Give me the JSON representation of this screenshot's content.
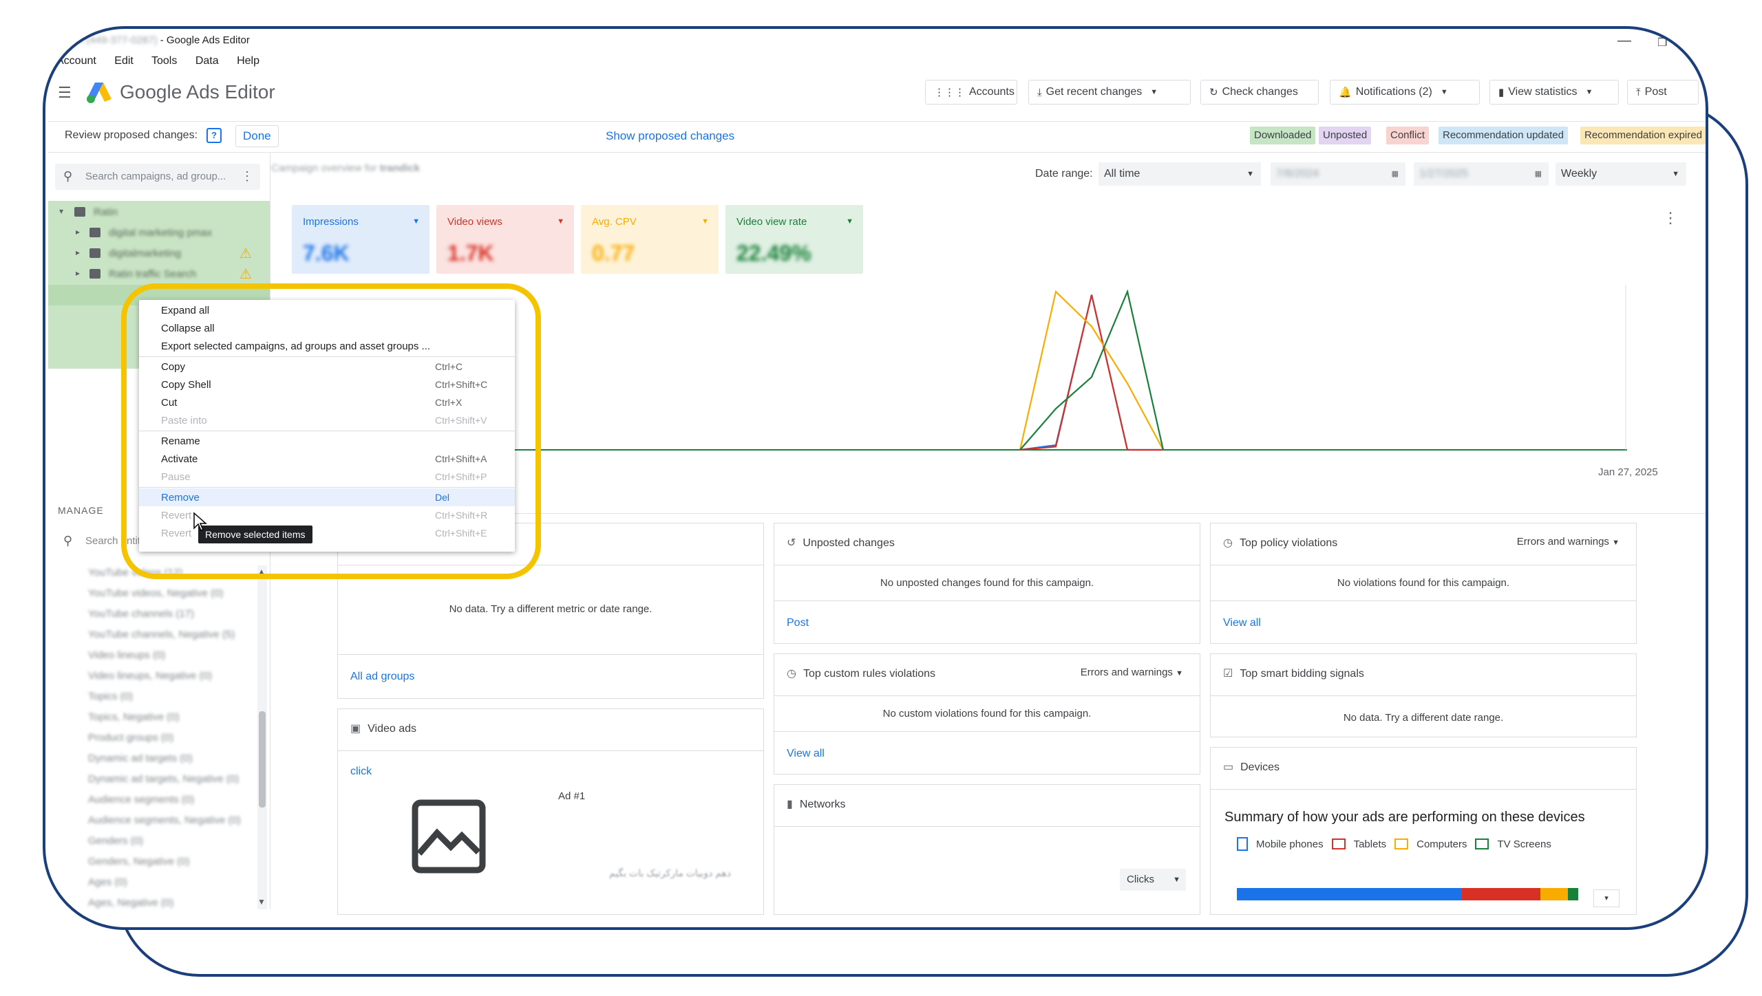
{
  "window": {
    "title_blurred": "Ratin (449-377-0287)",
    "title_suffix": " - Google Ads Editor",
    "minimize": "—",
    "restore": "❐"
  },
  "menu": {
    "account": "Account",
    "edit": "Edit",
    "tools": "Tools",
    "data": "Data",
    "help": "Help"
  },
  "header": {
    "app_title": "Google Ads Editor",
    "accounts": "Accounts",
    "get_recent": "Get recent changes",
    "check_changes": "Check changes",
    "notifications": "Notifications (2)",
    "view_statistics": "View statistics",
    "post": "Post"
  },
  "review": {
    "label": "Review proposed changes:",
    "help": "?",
    "done": "Done",
    "show": "Show proposed changes",
    "badges": {
      "downloaded": "Downloaded",
      "unposted": "Unposted",
      "conflict": "Conflict",
      "rec_updated": "Recommendation updated",
      "rec_expired": "Recommendation expired"
    },
    "colors": {
      "downloaded": "#c6e5c4",
      "unposted": "#e3d4f2",
      "conflict": "#f9d3d0",
      "rec_updated": "#cfe6f7",
      "rec_expired": "#fbe7b5"
    }
  },
  "sidebar": {
    "search_placeholder": "Search campaigns, ad group...",
    "tree": [
      {
        "label": "Ratin"
      },
      {
        "label": "digital marketing pmax"
      },
      {
        "label": "digitalmarketing"
      },
      {
        "label": "Ratin traffic Search"
      }
    ],
    "manage_label": "MANAGE",
    "manage_search_placeholder": "Search entities",
    "manage_items": [
      "YouTube videos (12)",
      "YouTube videos, Negative (0)",
      "YouTube channels (17)",
      "YouTube channels, Negative (5)",
      "Video lineups (0)",
      "Video lineups, Negative (0)",
      "Topics (0)",
      "Topics, Negative (0)",
      "Product groups (0)",
      "Dynamic ad targets (0)",
      "Dynamic ad targets, Negative (0)",
      "Audience segments (0)",
      "Audience segments, Negative (0)",
      "Genders (0)",
      "Genders, Negative (0)",
      "Ages (0)",
      "Ages, Negative (0)"
    ]
  },
  "overview": {
    "title": "Campaign overview for ",
    "campaign": "trandick",
    "date_range_label": "Date range:",
    "date_range_value": "All time",
    "date_from": "7/8/2024",
    "date_to": "1/27/2025",
    "period": "Weekly",
    "metrics": [
      {
        "label": "Impressions",
        "value": "7.6K",
        "color": "#1a73e8",
        "bg": "#e1ecfb"
      },
      {
        "label": "Video views",
        "value": "1.7K",
        "color": "#d93025",
        "bg": "#fbe3e1"
      },
      {
        "label": "Avg. CPV",
        "value": "0.77",
        "color": "#f9ab00",
        "bg": "#fef3d9"
      },
      {
        "label": "Video view rate",
        "value": "22.49%",
        "color": "#188038",
        "bg": "#e0f0e3"
      }
    ],
    "chart_end_label": "Jan 27, 2025"
  },
  "chart_data": {
    "type": "line",
    "x_end_label": "Jan 27, 2025",
    "series": [
      {
        "name": "Impressions",
        "color": "#1a73e8",
        "values": [
          0,
          0,
          0,
          0,
          0,
          0,
          0,
          0,
          0,
          0,
          0,
          0,
          0,
          0,
          0,
          0,
          0,
          0,
          0,
          0,
          0.06,
          0.98,
          0,
          0,
          0,
          0,
          0,
          0,
          0,
          0,
          0,
          0,
          0,
          0,
          0,
          0,
          0,
          0,
          0,
          0,
          0,
          0,
          0,
          0,
          0,
          0,
          0,
          0,
          0,
          0,
          0,
          0,
          0,
          0,
          0,
          0,
          0,
          0,
          0,
          0,
          0,
          0,
          0,
          0,
          0,
          0,
          0,
          0,
          0,
          0,
          0,
          0,
          0,
          0,
          0,
          0,
          0,
          0,
          0,
          0,
          0,
          0,
          0,
          0,
          0,
          0,
          0,
          0,
          0,
          0,
          0,
          0,
          0,
          0,
          0,
          0,
          0,
          0,
          0,
          0,
          0,
          0
        ]
      },
      {
        "name": "Video views",
        "color": "#d93025",
        "values": []
      },
      {
        "name": "Avg. CPV",
        "color": "#f9ab00",
        "values": []
      },
      {
        "name": "Video view rate",
        "color": "#188038",
        "values": []
      }
    ]
  },
  "context_menu": {
    "items": [
      {
        "label": "Expand all",
        "shortcut": "",
        "disabled": false
      },
      {
        "label": "Collapse all",
        "shortcut": "",
        "disabled": false
      },
      {
        "label": "Export selected campaigns, ad groups and asset groups ...",
        "shortcut": "",
        "disabled": false
      },
      {
        "label": "Copy",
        "shortcut": "Ctrl+C",
        "disabled": false
      },
      {
        "label": "Copy Shell",
        "shortcut": "Ctrl+Shift+C",
        "disabled": false
      },
      {
        "label": "Cut",
        "shortcut": "Ctrl+X",
        "disabled": false
      },
      {
        "label": "Paste into",
        "shortcut": "Ctrl+Shift+V",
        "disabled": true
      },
      {
        "label": "Rename",
        "shortcut": "",
        "disabled": false
      },
      {
        "label": "Activate",
        "shortcut": "Ctrl+Shift+A",
        "disabled": false
      },
      {
        "label": "Pause",
        "shortcut": "Ctrl+Shift+P",
        "disabled": true
      },
      {
        "label": "Remove",
        "shortcut": "Del",
        "disabled": false
      },
      {
        "label": "Revert",
        "shortcut": "Ctrl+Shift+R",
        "disabled": true
      },
      {
        "label": "Revert",
        "shortcut": "Ctrl+Shift+E",
        "disabled": true
      }
    ],
    "tooltip": "Remove selected items"
  },
  "cards": {
    "ad_groups": {
      "msg": "No data. Try a different metric or date range.",
      "link": "All ad groups"
    },
    "video_ads": {
      "title": "Video ads",
      "link": "click",
      "ad_label": "Ad #1",
      "ad_text": "دهم دوبيات مارکرتيک بات بگيم"
    },
    "unposted": {
      "title": "Unposted changes",
      "msg": "No unposted changes found for this campaign.",
      "link": "Post"
    },
    "custom_rules": {
      "title": "Top custom rules violations",
      "filter": "Errors and warnings",
      "msg": "No custom violations found for this campaign.",
      "link": "View all"
    },
    "networks": {
      "title": "Networks",
      "metric": "Clicks"
    },
    "policy": {
      "title": "Top policy violations",
      "filter": "Errors and warnings",
      "msg": "No violations found for this campaign.",
      "link": "View all"
    },
    "smart_bidding": {
      "title": "Top smart bidding signals",
      "msg": "No data. Try a different date range."
    },
    "devices": {
      "title": "Devices",
      "summary": "Summary of how your ads are performing on these devices",
      "legend": [
        "Mobile phones",
        "Tablets",
        "Computers",
        "TV Screens"
      ],
      "legend_colors": [
        "#1a73e8",
        "#d93025",
        "#f9ab00",
        "#188038"
      ],
      "shares": [
        0.66,
        0.23,
        0.08,
        0.03
      ]
    }
  }
}
